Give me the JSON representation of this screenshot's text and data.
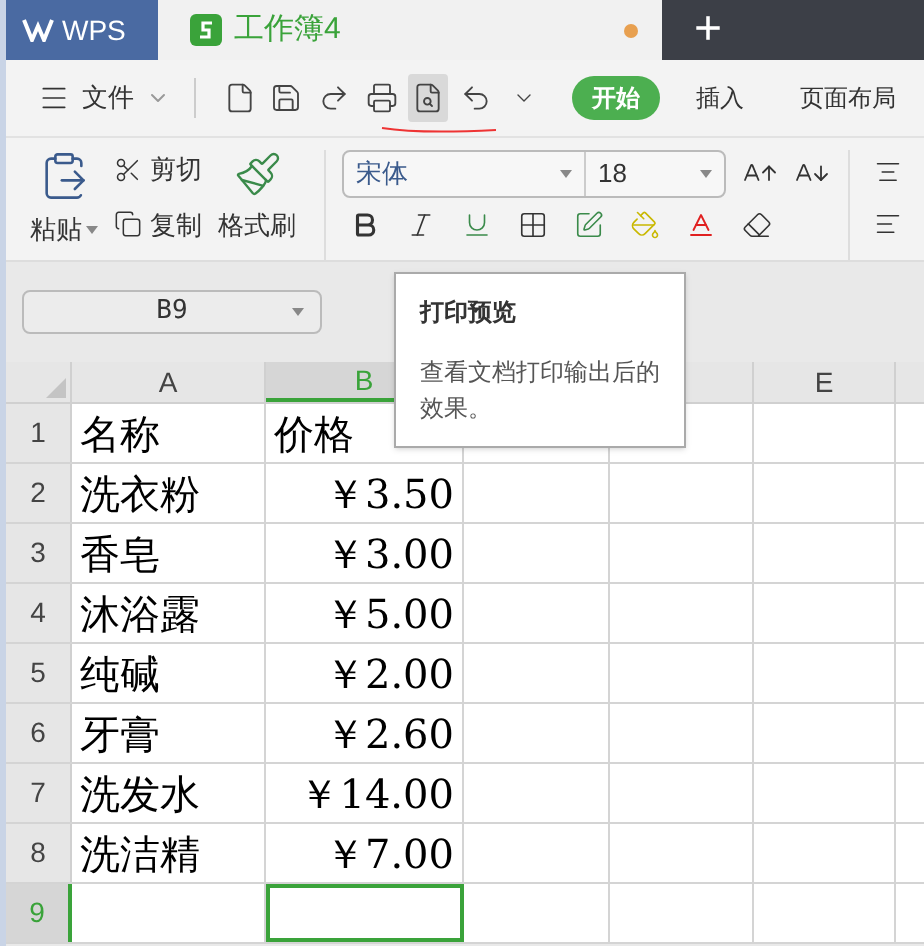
{
  "tabs": [
    {
      "kind": "home",
      "label": "WPS",
      "selected": false
    },
    {
      "kind": "sheet",
      "label": "工作簿4",
      "selected": true,
      "modified": true
    }
  ],
  "new_tab": {
    "label": "+"
  },
  "file_menu": {
    "label": "文件"
  },
  "quick_tools": [
    {
      "kind": "new",
      "highlighted": false
    },
    {
      "kind": "save",
      "highlighted": false
    },
    {
      "kind": "redo",
      "highlighted": false
    },
    {
      "kind": "print",
      "highlighted": false
    },
    {
      "kind": "preview",
      "highlighted": true
    },
    {
      "kind": "undo",
      "highlighted": false
    },
    {
      "kind": "more",
      "highlighted": false
    }
  ],
  "ribbon_tabs": [
    {
      "label": "开始",
      "selected": true
    },
    {
      "label": "插入",
      "selected": false
    },
    {
      "label": "页面布局",
      "selected": false
    }
  ],
  "clipboard": {
    "paste": "粘贴",
    "cut": "剪切",
    "copy": "复制",
    "format_painter": "格式刷"
  },
  "font": {
    "family": "宋体",
    "size": "18"
  },
  "name_box": {
    "value": "B9"
  },
  "tooltip": {
    "title": "打印预览",
    "text": "查看文档打印输出后的效果。"
  },
  "columns": [
    {
      "kind": "visible",
      "label": "A",
      "selected": false
    },
    {
      "kind": "visible",
      "label": "B",
      "selected": true
    },
    {
      "kind": "covered"
    },
    {
      "kind": "covered"
    },
    {
      "kind": "visible",
      "label": "E",
      "selected": false
    }
  ],
  "rows": [
    {
      "number": "1",
      "selected": false,
      "cells": [
        {
          "kind": "text",
          "text": "名称"
        },
        {
          "kind": "text",
          "text": "价格"
        }
      ]
    },
    {
      "number": "2",
      "selected": false,
      "cells": [
        {
          "kind": "text",
          "text": "洗衣粉"
        },
        {
          "kind": "number",
          "text": "￥3.50"
        }
      ]
    },
    {
      "number": "3",
      "selected": false,
      "cells": [
        {
          "kind": "text",
          "text": "香皂"
        },
        {
          "kind": "number",
          "text": "￥3.00"
        }
      ]
    },
    {
      "number": "4",
      "selected": false,
      "cells": [
        {
          "kind": "text",
          "text": "沐浴露"
        },
        {
          "kind": "number",
          "text": "￥5.00"
        }
      ]
    },
    {
      "number": "5",
      "selected": false,
      "cells": [
        {
          "kind": "text",
          "text": "纯碱"
        },
        {
          "kind": "number",
          "text": "￥2.00"
        }
      ]
    },
    {
      "number": "6",
      "selected": false,
      "cells": [
        {
          "kind": "text",
          "text": "牙膏"
        },
        {
          "kind": "number",
          "text": "￥2.60"
        }
      ]
    },
    {
      "number": "7",
      "selected": false,
      "cells": [
        {
          "kind": "text",
          "text": "洗发水"
        },
        {
          "kind": "number",
          "text": "￥14.00"
        }
      ]
    },
    {
      "number": "8",
      "selected": false,
      "cells": [
        {
          "kind": "text",
          "text": "洗洁精"
        },
        {
          "kind": "number",
          "text": "￥7.00"
        }
      ]
    },
    {
      "number": "9",
      "selected": true,
      "cells": []
    }
  ]
}
